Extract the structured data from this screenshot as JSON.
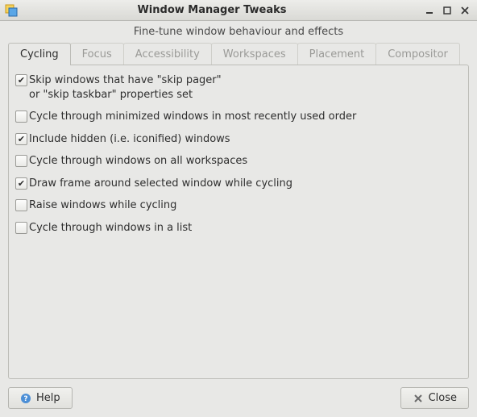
{
  "window": {
    "title": "Window Manager Tweaks",
    "subtitle": "Fine-tune window behaviour and effects"
  },
  "tabs": [
    {
      "label": "Cycling",
      "active": true
    },
    {
      "label": "Focus",
      "active": false
    },
    {
      "label": "Accessibility",
      "active": false
    },
    {
      "label": "Workspaces",
      "active": false
    },
    {
      "label": "Placement",
      "active": false
    },
    {
      "label": "Compositor",
      "active": false
    }
  ],
  "cycling_options": [
    {
      "label": "Skip windows that have \"skip pager\"\nor \"skip taskbar\" properties set",
      "checked": true
    },
    {
      "label": "Cycle through minimized windows in most recently used order",
      "checked": false
    },
    {
      "label": "Include hidden (i.e. iconified) windows",
      "checked": true
    },
    {
      "label": "Cycle through windows on all workspaces",
      "checked": false
    },
    {
      "label": "Draw frame around selected window while cycling",
      "checked": true
    },
    {
      "label": "Raise windows while cycling",
      "checked": false
    },
    {
      "label": "Cycle through windows in a list",
      "checked": false
    }
  ],
  "buttons": {
    "help": "Help",
    "close": "Close"
  }
}
